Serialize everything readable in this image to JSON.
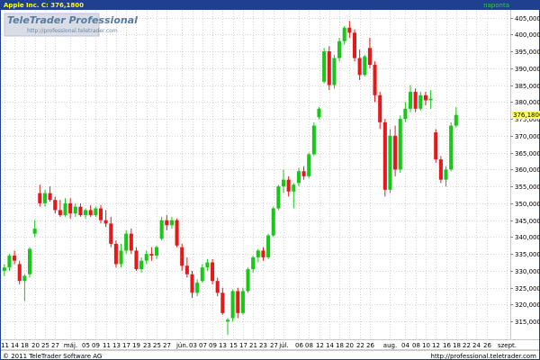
{
  "header": {
    "symbol_quote": "Apple Inc.  C: 376,1800",
    "mode": "naponta"
  },
  "watermark": {
    "title": "TeleTrader Professional",
    "url": "http://professional.teletrader.com"
  },
  "footer": {
    "copyright": "© 2011 TeleTrader Software AG",
    "url": "http://professional.teletrader.com"
  },
  "colors": {
    "up": "#19c719",
    "down": "#e51919",
    "header_bg": "#1f3f8f",
    "last_marker": "#ffff66"
  },
  "chart_data": {
    "type": "candlestick",
    "instrument": "Apple Inc.",
    "interval": "naponta",
    "last_close": 376.18,
    "last_close_label": "376,1800",
    "ylim": [
      310,
      407
    ],
    "y_ticks": [
      "315,0000",
      "320,0000",
      "325,0000",
      "330,0000",
      "335,0000",
      "340,0000",
      "345,0000",
      "350,0000",
      "355,0000",
      "360,0000",
      "365,0000",
      "370,0000",
      "375,0000",
      "380,0000",
      "385,0000",
      "390,0000",
      "395,0000",
      "400,0000",
      "405,0000"
    ],
    "y_tick_values": [
      315,
      320,
      325,
      330,
      335,
      340,
      345,
      350,
      355,
      360,
      365,
      370,
      375,
      380,
      385,
      390,
      395,
      400,
      405
    ],
    "x_ticks": [
      "11",
      "14",
      "18",
      "20",
      "25",
      "27",
      "máj.",
      "05",
      "09",
      "11",
      "13",
      "17",
      "19",
      "23",
      "25",
      "27",
      "jún.",
      "03",
      "07",
      "09",
      "13",
      "15",
      "17",
      "21",
      "23",
      "27",
      "júl.",
      "06",
      "08",
      "12",
      "14",
      "18",
      "20",
      "22",
      "26",
      "aug.",
      "04",
      "08",
      "10",
      "12",
      "16",
      "18",
      "22",
      "24",
      "26",
      "szept."
    ],
    "x_tick_index": [
      0,
      2,
      4,
      6,
      8,
      10,
      13,
      16,
      18,
      20,
      22,
      24,
      26,
      28,
      30,
      32,
      35,
      37,
      39,
      41,
      43,
      45,
      47,
      49,
      51,
      53,
      55,
      58,
      60,
      62,
      64,
      66,
      68,
      70,
      72,
      76,
      79,
      81,
      83,
      85,
      87,
      89,
      91,
      93,
      95,
      99
    ],
    "candles": [
      {
        "o": 330.0,
        "h": 332.0,
        "l": 328.5,
        "c": 331.0
      },
      {
        "o": 331.0,
        "h": 335.0,
        "l": 330.0,
        "c": 334.5
      },
      {
        "o": 334.5,
        "h": 336.0,
        "l": 332.0,
        "c": 333.0
      },
      {
        "o": 332.0,
        "h": 333.0,
        "l": 326.0,
        "c": 327.0
      },
      {
        "o": 327.0,
        "h": 329.0,
        "l": 321.0,
        "c": 328.5
      },
      {
        "o": 329.0,
        "h": 337.0,
        "l": 328.0,
        "c": 336.5
      },
      {
        "o": 341.0,
        "h": 345.0,
        "l": 340.0,
        "c": 342.5
      },
      {
        "o": 353.0,
        "h": 355.5,
        "l": 349.0,
        "c": 350.0
      },
      {
        "o": 350.0,
        "h": 354.0,
        "l": 349.0,
        "c": 353.0
      },
      {
        "o": 353.0,
        "h": 355.0,
        "l": 350.5,
        "c": 351.0
      },
      {
        "o": 351.0,
        "h": 352.0,
        "l": 347.0,
        "c": 348.0
      },
      {
        "o": 348.0,
        "h": 351.0,
        "l": 346.0,
        "c": 346.5
      },
      {
        "o": 346.5,
        "h": 351.5,
        "l": 346.0,
        "c": 350.0
      },
      {
        "o": 350.0,
        "h": 351.5,
        "l": 345.5,
        "c": 347.0
      },
      {
        "o": 347.0,
        "h": 350.0,
        "l": 346.0,
        "c": 349.0
      },
      {
        "o": 349.0,
        "h": 350.0,
        "l": 346.0,
        "c": 346.5
      },
      {
        "o": 346.5,
        "h": 348.5,
        "l": 345.5,
        "c": 348.0
      },
      {
        "o": 348.0,
        "h": 349.5,
        "l": 346.0,
        "c": 346.5
      },
      {
        "o": 346.5,
        "h": 349.0,
        "l": 346.0,
        "c": 348.5
      },
      {
        "o": 348.5,
        "h": 349.5,
        "l": 344.0,
        "c": 345.0
      },
      {
        "o": 345.0,
        "h": 348.0,
        "l": 343.0,
        "c": 344.0
      },
      {
        "o": 344.0,
        "h": 346.0,
        "l": 337.0,
        "c": 338.0
      },
      {
        "o": 338.0,
        "h": 339.0,
        "l": 331.0,
        "c": 332.0
      },
      {
        "o": 332.0,
        "h": 338.0,
        "l": 331.0,
        "c": 336.0
      },
      {
        "o": 336.0,
        "h": 342.0,
        "l": 335.0,
        "c": 341.0
      },
      {
        "o": 341.0,
        "h": 342.5,
        "l": 335.0,
        "c": 336.0
      },
      {
        "o": 336.0,
        "h": 337.0,
        "l": 330.0,
        "c": 330.5
      },
      {
        "o": 330.5,
        "h": 334.0,
        "l": 329.5,
        "c": 333.0
      },
      {
        "o": 333.0,
        "h": 336.0,
        "l": 332.0,
        "c": 335.0
      },
      {
        "o": 335.0,
        "h": 337.0,
        "l": 333.0,
        "c": 334.5
      },
      {
        "o": 334.5,
        "h": 337.5,
        "l": 333.5,
        "c": 337.0
      },
      {
        "o": 339.5,
        "h": 346.0,
        "l": 339.0,
        "c": 345.0
      },
      {
        "o": 345.0,
        "h": 346.5,
        "l": 342.0,
        "c": 343.5
      },
      {
        "o": 343.5,
        "h": 346.0,
        "l": 342.5,
        "c": 345.0
      },
      {
        "o": 345.0,
        "h": 345.5,
        "l": 337.0,
        "c": 337.5
      },
      {
        "o": 337.0,
        "h": 338.0,
        "l": 330.0,
        "c": 331.5
      },
      {
        "o": 331.5,
        "h": 334.0,
        "l": 328.0,
        "c": 329.0
      },
      {
        "o": 329.0,
        "h": 330.0,
        "l": 322.0,
        "c": 323.5
      },
      {
        "o": 323.5,
        "h": 327.5,
        "l": 322.5,
        "c": 326.5
      },
      {
        "o": 327.0,
        "h": 332.0,
        "l": 326.5,
        "c": 331.0
      },
      {
        "o": 331.0,
        "h": 333.5,
        "l": 330.0,
        "c": 332.5
      },
      {
        "o": 332.5,
        "h": 333.5,
        "l": 326.0,
        "c": 327.0
      },
      {
        "o": 327.0,
        "h": 328.0,
        "l": 322.5,
        "c": 323.5
      },
      {
        "o": 323.5,
        "h": 325.0,
        "l": 317.0,
        "c": 317.5
      },
      {
        "o": 315.0,
        "h": 316.0,
        "l": 311.0,
        "c": 315.5
      },
      {
        "o": 316.0,
        "h": 324.5,
        "l": 315.0,
        "c": 324.0
      },
      {
        "o": 324.0,
        "h": 325.0,
        "l": 316.0,
        "c": 317.5
      },
      {
        "o": 317.5,
        "h": 325.0,
        "l": 317.0,
        "c": 324.0
      },
      {
        "o": 324.0,
        "h": 331.0,
        "l": 323.5,
        "c": 330.5
      },
      {
        "o": 330.5,
        "h": 334.5,
        "l": 329.5,
        "c": 334.0
      },
      {
        "o": 334.0,
        "h": 336.5,
        "l": 332.5,
        "c": 336.0
      },
      {
        "o": 336.0,
        "h": 337.0,
        "l": 333.0,
        "c": 334.0
      },
      {
        "o": 334.0,
        "h": 341.0,
        "l": 333.5,
        "c": 340.5
      },
      {
        "o": 340.5,
        "h": 349.0,
        "l": 340.0,
        "c": 348.5
      },
      {
        "o": 348.5,
        "h": 355.5,
        "l": 348.0,
        "c": 355.0
      },
      {
        "o": 355.0,
        "h": 360.0,
        "l": 353.0,
        "c": 357.0
      },
      {
        "o": 357.0,
        "h": 358.0,
        "l": 352.0,
        "c": 353.5
      },
      {
        "o": 353.5,
        "h": 356.0,
        "l": 348.5,
        "c": 355.5
      },
      {
        "o": 356.0,
        "h": 360.5,
        "l": 355.0,
        "c": 359.5
      },
      {
        "o": 359.5,
        "h": 361.0,
        "l": 357.0,
        "c": 358.0
      },
      {
        "o": 358.0,
        "h": 365.0,
        "l": 357.5,
        "c": 364.5
      },
      {
        "o": 364.5,
        "h": 374.0,
        "l": 364.0,
        "c": 373.0
      },
      {
        "o": 375.5,
        "h": 378.5,
        "l": 375.0,
        "c": 378.0
      },
      {
        "o": 386.0,
        "h": 396.0,
        "l": 385.5,
        "c": 395.0
      },
      {
        "o": 395.0,
        "h": 396.5,
        "l": 383.5,
        "c": 385.0
      },
      {
        "o": 385.0,
        "h": 394.0,
        "l": 384.0,
        "c": 393.0
      },
      {
        "o": 393.0,
        "h": 399.0,
        "l": 392.0,
        "c": 398.0
      },
      {
        "o": 398.0,
        "h": 402.5,
        "l": 397.0,
        "c": 402.0
      },
      {
        "o": 402.0,
        "h": 404.0,
        "l": 399.0,
        "c": 400.5
      },
      {
        "o": 400.5,
        "h": 401.5,
        "l": 392.0,
        "c": 393.0
      },
      {
        "o": 393.0,
        "h": 395.5,
        "l": 386.5,
        "c": 388.0
      },
      {
        "o": 388.0,
        "h": 394.0,
        "l": 387.5,
        "c": 393.5
      },
      {
        "o": 396.0,
        "h": 399.0,
        "l": 390.0,
        "c": 391.0
      },
      {
        "o": 391.0,
        "h": 392.0,
        "l": 380.0,
        "c": 382.0
      },
      {
        "o": 382.0,
        "h": 383.0,
        "l": 372.0,
        "c": 374.0
      },
      {
        "o": 374.0,
        "h": 375.0,
        "l": 352.0,
        "c": 354.0
      },
      {
        "o": 354.0,
        "h": 372.0,
        "l": 353.0,
        "c": 370.0
      },
      {
        "o": 370.0,
        "h": 373.0,
        "l": 358.0,
        "c": 360.0
      },
      {
        "o": 360.0,
        "h": 376.0,
        "l": 359.0,
        "c": 375.0
      },
      {
        "o": 375.0,
        "h": 380.0,
        "l": 374.0,
        "c": 378.0
      },
      {
        "o": 378.0,
        "h": 385.0,
        "l": 377.0,
        "c": 383.0
      },
      {
        "o": 383.0,
        "h": 384.0,
        "l": 377.0,
        "c": 378.0
      },
      {
        "o": 378.0,
        "h": 383.0,
        "l": 377.5,
        "c": 382.0
      },
      {
        "o": 382.0,
        "h": 383.0,
        "l": 379.0,
        "c": 380.5
      },
      {
        "o": 380.5,
        "h": 383.5,
        "l": 378.0,
        "c": 381.0
      },
      {
        "o": 371.0,
        "h": 372.0,
        "l": 362.0,
        "c": 363.0
      },
      {
        "o": 363.0,
        "h": 364.0,
        "l": 356.0,
        "c": 357.0
      },
      {
        "o": 357.0,
        "h": 361.0,
        "l": 355.0,
        "c": 360.0
      },
      {
        "o": 360.0,
        "h": 374.0,
        "l": 359.5,
        "c": 373.0
      },
      {
        "o": 373.0,
        "h": 378.5,
        "l": 372.5,
        "c": 376.18
      }
    ]
  }
}
